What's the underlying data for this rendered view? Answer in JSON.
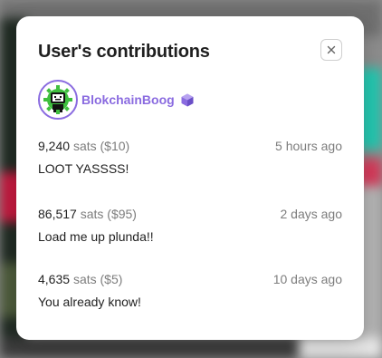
{
  "modal": {
    "title": "User's contributions"
  },
  "user": {
    "name": "BlokchainBoog",
    "avatar_icon": "robot-avatar-icon",
    "badge_icon": "hexagon-badge-icon",
    "accent": "#8a6be0"
  },
  "contributions": [
    {
      "amount": "9,240",
      "unit": "sats ($10)",
      "time": "5 hours ago",
      "message": "LOOT YASSSS!"
    },
    {
      "amount": "86,517",
      "unit": "sats ($95)",
      "time": "2 days ago",
      "message": "Load me up plunda!!"
    },
    {
      "amount": "4,635",
      "unit": "sats ($5)",
      "time": "10 days ago",
      "message": "You already know!"
    }
  ]
}
